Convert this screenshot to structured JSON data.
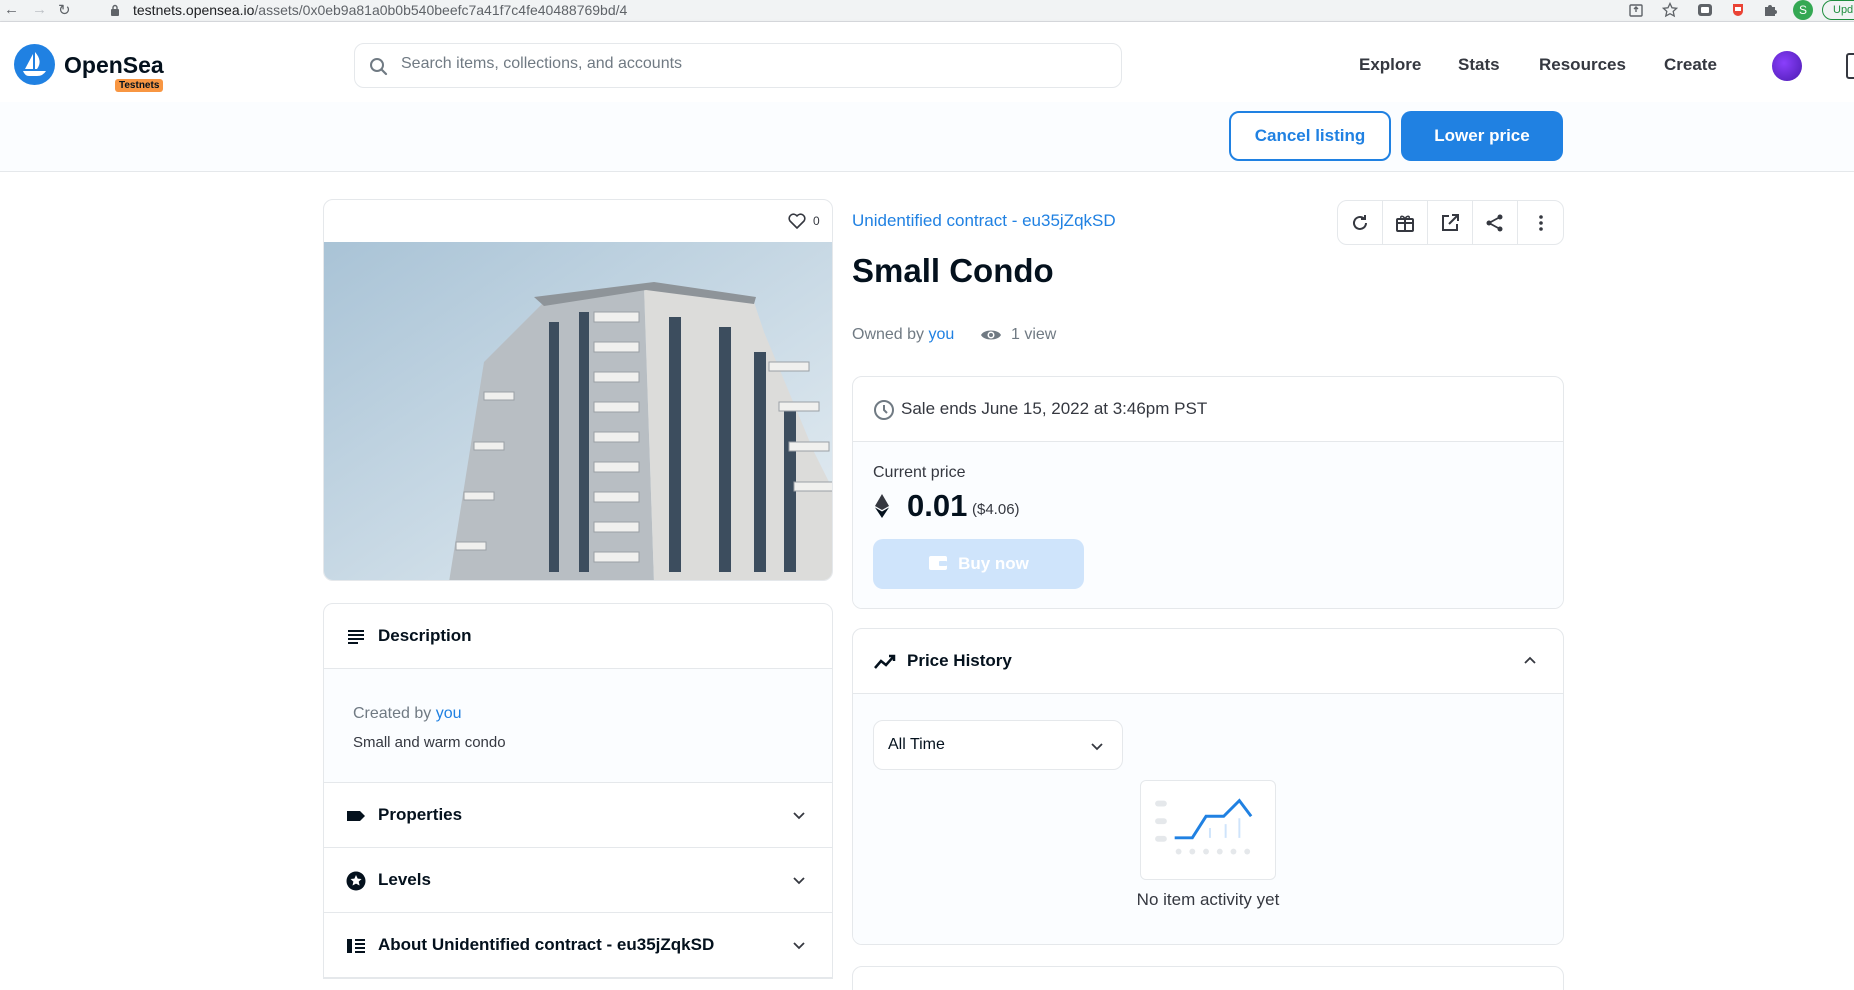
{
  "browser": {
    "url_host": "testnets.opensea.io",
    "url_path": "/assets/0x0eb9a81a0b0b540beefc7a41f7c4fe40488769bd/4",
    "profile_initial": "S",
    "update_label": "Upd"
  },
  "header": {
    "logo_text": "OpenSea",
    "badge": "Testnets",
    "search_placeholder": "Search items, collections, and accounts",
    "nav": [
      "Explore",
      "Stats",
      "Resources",
      "Create"
    ]
  },
  "owner_actions": {
    "cancel_label": "Cancel listing",
    "lower_label": "Lower price"
  },
  "media": {
    "favorites": "0"
  },
  "description": {
    "title": "Description",
    "created_prefix": "Created by",
    "creator": "you",
    "text": "Small and warm condo"
  },
  "sections": {
    "properties": "Properties",
    "levels": "Levels",
    "about": "About Unidentified contract - eu35jZqkSD"
  },
  "item": {
    "contract": "Unidentified contract - eu35jZqkSD",
    "name": "Small Condo",
    "owned_prefix": "Owned by",
    "owner": "you",
    "views": "1 view"
  },
  "sale": {
    "ends": "Sale ends June 15, 2022 at 3:46pm PST",
    "current_price_label": "Current price",
    "price": "0.01",
    "price_usd": "($4.06)",
    "buy_label": "Buy now"
  },
  "price_history": {
    "title": "Price History",
    "range": "All Time",
    "empty": "No item activity yet"
  },
  "colors": {
    "accent": "#2081e2",
    "badge": "#f89642",
    "text": "#04111d",
    "muted": "#707a83"
  }
}
